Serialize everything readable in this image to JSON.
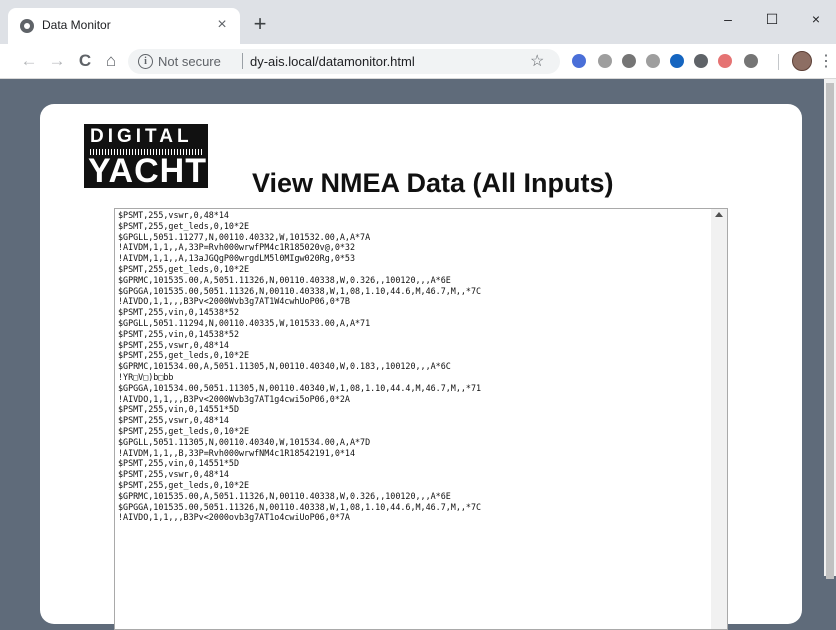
{
  "browser": {
    "tab_title": "Data Monitor",
    "tab_close": "×",
    "new_tab": "+",
    "security_label": "Not secure",
    "url": "dy-ais.local/datamonitor.html",
    "window_controls": {
      "minimize": "–",
      "maximize": "☐",
      "close": "×"
    },
    "icons": {
      "back": "←",
      "forward": "→",
      "reload": "C",
      "home": "⌂",
      "info": "i",
      "star": "☆",
      "menu": "⋮"
    },
    "extension_colors": [
      "#4a6fd8",
      "#9e9e9e",
      "#757575",
      "#9e9e9e",
      "#1565c0",
      "#5f6368",
      "#e57373",
      "#757575"
    ]
  },
  "page": {
    "logo_line1": "DIGITAL",
    "logo_line2": "YACHT",
    "title": "View NMEA Data (All Inputs)",
    "nmea_lines": [
      "$PSMT,255,vswr,0,48*14",
      "$PSMT,255,get_leds,0,10*2E",
      "$GPGLL,5051.11277,N,00110.40332,W,101532.00,A,A*7A",
      "!AIVDM,1,1,,A,33P=Rvh000wrwfPM4c1R185020v@,0*32",
      "!AIVDM,1,1,,A,13aJGQgP00wrgdLM5l0MIgw020Rg,0*53",
      "$PSMT,255,get_leds,0,10*2E",
      "$GPRMC,101535.00,A,5051.11326,N,00110.40338,W,0.326,,100120,,,A*6E",
      "$GPGGA,101535.00,5051.11326,N,00110.40338,W,1,08,1.10,44.6,M,46.7,M,,*7C",
      "!AIVDO,1,1,,,B3Pv<2000Wvb3g7AT1W4cwhUoP06,0*7B",
      "$PSMT,255,vin,0,14538*52",
      "$GPGLL,5051.11294,N,00110.40335,W,101533.00,A,A*71",
      "$PSMT,255,vin,0,14538*52",
      "$PSMT,255,vswr,0,48*14",
      "$PSMT,255,get_leds,0,10*2E",
      "$GPRMC,101534.00,A,5051.11305,N,00110.40340,W,0.183,,100120,,,A*6C",
      "!YR□V□)b□bb",
      "$GPGGA,101534.00,5051.11305,N,00110.40340,W,1,08,1.10,44.4,M,46.7,M,,*71",
      "!AIVDO,1,1,,,B3Pv<2000Wvb3g7AT1g4cwi5oP06,0*2A",
      "$PSMT,255,vin,0,14551*5D",
      "$PSMT,255,vswr,0,48*14",
      "$PSMT,255,get_leds,0,10*2E",
      "$GPGLL,5051.11305,N,00110.40340,W,101534.00,A,A*7D",
      "!AIVDM,1,1,,B,33P=Rvh000wrwfNM4c1R18542191,0*14",
      "$PSMT,255,vin,0,14551*5D",
      "$PSMT,255,vswr,0,48*14",
      "$PSMT,255,get_leds,0,10*2E",
      "$GPRMC,101535.00,A,5051.11326,N,00110.40338,W,0.326,,100120,,,A*6E",
      "$GPGGA,101535.00,5051.11326,N,00110.40338,W,1,08,1.10,44.6,M,46.7,M,,*7C",
      "!AIVDO,1,1,,,B3Pv<2000ovb3g7AT1o4cwiUoP06,0*7A"
    ]
  }
}
